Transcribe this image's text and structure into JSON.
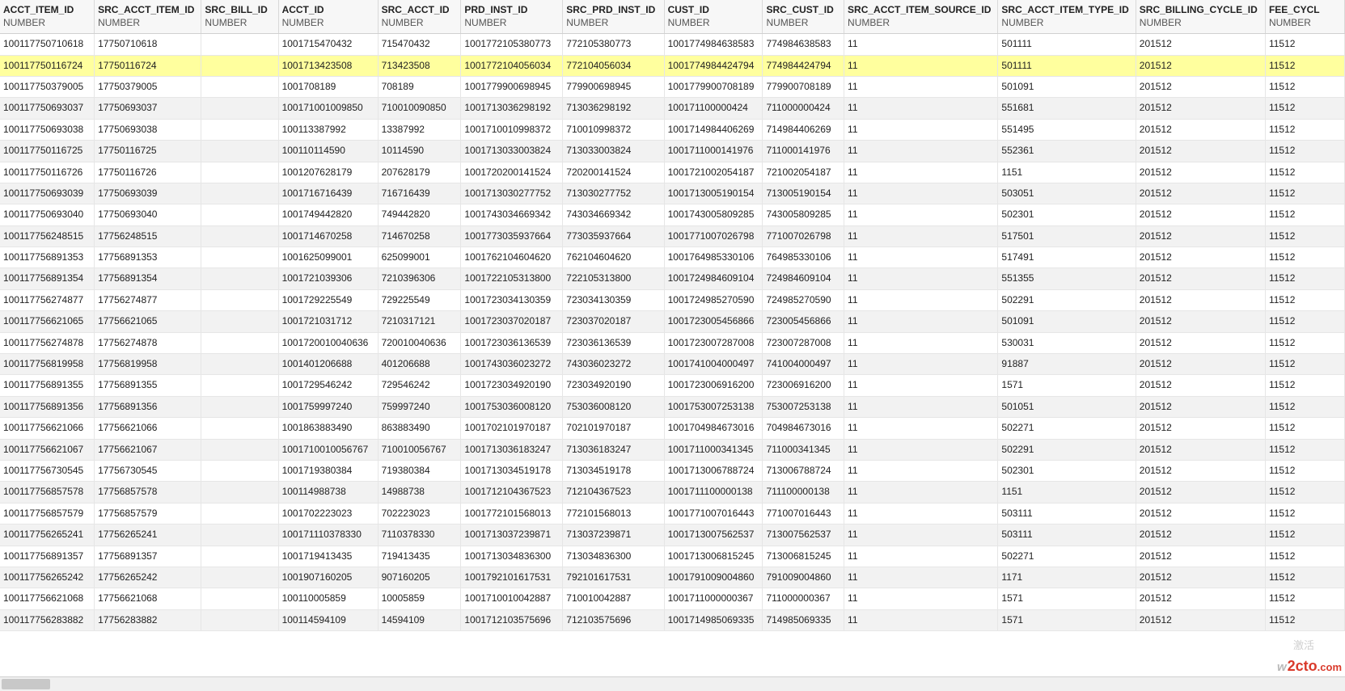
{
  "columns": [
    {
      "name": "ACCT_ITEM_ID",
      "type": "NUMBER"
    },
    {
      "name": "SRC_ACCT_ITEM_ID",
      "type": "NUMBER"
    },
    {
      "name": "SRC_BILL_ID",
      "type": "NUMBER"
    },
    {
      "name": "ACCT_ID",
      "type": "NUMBER"
    },
    {
      "name": "SRC_ACCT_ID",
      "type": "NUMBER"
    },
    {
      "name": "PRD_INST_ID",
      "type": "NUMBER"
    },
    {
      "name": "SRC_PRD_INST_ID",
      "type": "NUMBER"
    },
    {
      "name": "CUST_ID",
      "type": "NUMBER"
    },
    {
      "name": "SRC_CUST_ID",
      "type": "NUMBER"
    },
    {
      "name": "SRC_ACCT_ITEM_SOURCE_ID",
      "type": "NUMBER"
    },
    {
      "name": "SRC_ACCT_ITEM_TYPE_ID",
      "type": "NUMBER"
    },
    {
      "name": "SRC_BILLING_CYCLE_ID",
      "type": "NUMBER"
    },
    {
      "name": "FEE_CYCL",
      "type": "NUMBER"
    }
  ],
  "highlighted_row_index": 1,
  "rows": [
    [
      "100117750710618",
      "17750710618",
      "",
      "1001715470432",
      "715470432",
      "1001772105380773",
      "772105380773",
      "1001774984638583",
      "774984638583",
      "11",
      "501111",
      "201512",
      "11512"
    ],
    [
      "100117750116724",
      "17750116724",
      "",
      "1001713423508",
      "713423508",
      "1001772104056034",
      "772104056034",
      "1001774984424794",
      "774984424794",
      "11",
      "501111",
      "201512",
      "11512"
    ],
    [
      "100117750379005",
      "17750379005",
      "",
      "1001708189",
      "708189",
      "1001779900698945",
      "779900698945",
      "1001779900708189",
      "779900708189",
      "11",
      "501091",
      "201512",
      "11512"
    ],
    [
      "100117750693037",
      "17750693037",
      "",
      "100171001009850",
      "710010090850",
      "1001713036298192",
      "713036298192",
      "100171100000424",
      "711000000424",
      "11",
      "551681",
      "201512",
      "11512"
    ],
    [
      "100117750693038",
      "17750693038",
      "",
      "100113387992",
      "13387992",
      "1001710010998372",
      "710010998372",
      "1001714984406269",
      "714984406269",
      "11",
      "551495",
      "201512",
      "11512"
    ],
    [
      "100117750116725",
      "17750116725",
      "",
      "100110114590",
      "10114590",
      "1001713033003824",
      "713033003824",
      "1001711000141976",
      "711000141976",
      "11",
      "552361",
      "201512",
      "11512"
    ],
    [
      "100117750116726",
      "17750116726",
      "",
      "1001207628179",
      "207628179",
      "1001720200141524",
      "720200141524",
      "1001721002054187",
      "721002054187",
      "11",
      "1151",
      "201512",
      "11512"
    ],
    [
      "100117750693039",
      "17750693039",
      "",
      "1001716716439",
      "716716439",
      "1001713030277752",
      "713030277752",
      "1001713005190154",
      "713005190154",
      "11",
      "503051",
      "201512",
      "11512"
    ],
    [
      "100117750693040",
      "17750693040",
      "",
      "1001749442820",
      "749442820",
      "1001743034669342",
      "743034669342",
      "1001743005809285",
      "743005809285",
      "11",
      "502301",
      "201512",
      "11512"
    ],
    [
      "100117756248515",
      "17756248515",
      "",
      "1001714670258",
      "714670258",
      "1001773035937664",
      "773035937664",
      "1001771007026798",
      "771007026798",
      "11",
      "517501",
      "201512",
      "11512"
    ],
    [
      "100117756891353",
      "17756891353",
      "",
      "1001625099001",
      "625099001",
      "1001762104604620",
      "762104604620",
      "1001764985330106",
      "764985330106",
      "11",
      "517491",
      "201512",
      "11512"
    ],
    [
      "100117756891354",
      "17756891354",
      "",
      "1001721039306",
      "7210396306",
      "1001722105313800",
      "722105313800",
      "1001724984609104",
      "724984609104",
      "11",
      "551355",
      "201512",
      "11512"
    ],
    [
      "100117756274877",
      "17756274877",
      "",
      "1001729225549",
      "729225549",
      "1001723034130359",
      "723034130359",
      "1001724985270590",
      "724985270590",
      "11",
      "502291",
      "201512",
      "11512"
    ],
    [
      "100117756621065",
      "17756621065",
      "",
      "1001721031712",
      "7210317121",
      "1001723037020187",
      "723037020187",
      "1001723005456866",
      "723005456866",
      "11",
      "501091",
      "201512",
      "11512"
    ],
    [
      "100117756274878",
      "17756274878",
      "",
      "1001720010040636",
      "720010040636",
      "1001723036136539",
      "723036136539",
      "1001723007287008",
      "723007287008",
      "11",
      "530031",
      "201512",
      "11512"
    ],
    [
      "100117756819958",
      "17756819958",
      "",
      "1001401206688",
      "401206688",
      "1001743036023272",
      "743036023272",
      "1001741004000497",
      "741004000497",
      "11",
      "91887",
      "201512",
      "11512"
    ],
    [
      "100117756891355",
      "17756891355",
      "",
      "1001729546242",
      "729546242",
      "1001723034920190",
      "723034920190",
      "1001723006916200",
      "723006916200",
      "11",
      "1571",
      "201512",
      "11512"
    ],
    [
      "100117756891356",
      "17756891356",
      "",
      "1001759997240",
      "759997240",
      "1001753036008120",
      "753036008120",
      "1001753007253138",
      "753007253138",
      "11",
      "501051",
      "201512",
      "11512"
    ],
    [
      "100117756621066",
      "17756621066",
      "",
      "1001863883490",
      "863883490",
      "1001702101970187",
      "702101970187",
      "1001704984673016",
      "704984673016",
      "11",
      "502271",
      "201512",
      "11512"
    ],
    [
      "100117756621067",
      "17756621067",
      "",
      "1001710010056767",
      "710010056767",
      "1001713036183247",
      "713036183247",
      "1001711000341345",
      "711000341345",
      "11",
      "502291",
      "201512",
      "11512"
    ],
    [
      "100117756730545",
      "17756730545",
      "",
      "1001719380384",
      "719380384",
      "1001713034519178",
      "713034519178",
      "1001713006788724",
      "713006788724",
      "11",
      "502301",
      "201512",
      "11512"
    ],
    [
      "100117756857578",
      "17756857578",
      "",
      "100114988738",
      "14988738",
      "1001712104367523",
      "712104367523",
      "1001711100000138",
      "711100000138",
      "11",
      "1151",
      "201512",
      "11512"
    ],
    [
      "100117756857579",
      "17756857579",
      "",
      "1001702223023",
      "702223023",
      "1001772101568013",
      "772101568013",
      "1001771007016443",
      "771007016443",
      "11",
      "503111",
      "201512",
      "11512"
    ],
    [
      "100117756265241",
      "17756265241",
      "",
      "100171110378330",
      "7110378330",
      "1001713037239871",
      "713037239871",
      "1001713007562537",
      "713007562537",
      "11",
      "503111",
      "201512",
      "11512"
    ],
    [
      "100117756891357",
      "17756891357",
      "",
      "1001719413435",
      "719413435",
      "1001713034836300",
      "713034836300",
      "1001713006815245",
      "713006815245",
      "11",
      "502271",
      "201512",
      "11512"
    ],
    [
      "100117756265242",
      "17756265242",
      "",
      "1001907160205",
      "907160205",
      "1001792101617531",
      "792101617531",
      "1001791009004860",
      "791009004860",
      "11",
      "1171",
      "201512",
      "11512"
    ],
    [
      "100117756621068",
      "17756621068",
      "",
      "100110005859",
      "10005859",
      "1001710010042887",
      "710010042887",
      "1001711000000367",
      "711000000367",
      "11",
      "1571",
      "201512",
      "11512"
    ],
    [
      "100117756283882",
      "17756283882",
      "",
      "100114594109",
      "14594109",
      "1001712103575696",
      "712103575696",
      "1001714985069335",
      "714985069335",
      "11",
      "1571",
      "201512",
      "11512"
    ]
  ],
  "watermark": {
    "faint": "激活",
    "brand_main": "2cto",
    "brand_suffix": ".com",
    "prefix": "w"
  },
  "colors": {
    "highlight": "#ffff9e",
    "brand": "#d93a2b"
  }
}
